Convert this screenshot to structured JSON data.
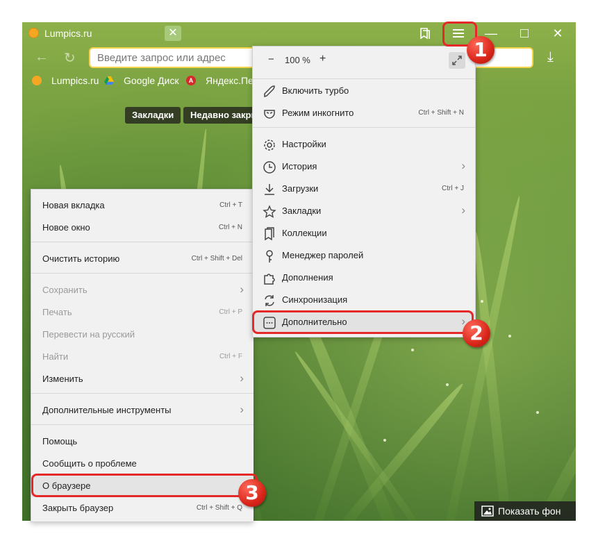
{
  "tab": {
    "title": "Lumpics.ru",
    "close_glyph": "✕"
  },
  "window_controls": {
    "collections_icon": "bookmark-stack-icon",
    "menu_icon": "hamburger-menu-icon",
    "minimize": "—",
    "maximize": "□",
    "close": "✕"
  },
  "address": {
    "placeholder": "Введите запрос или адрес"
  },
  "bookmarks_bar": [
    {
      "label": "Lumpics.ru",
      "icon": "orange-circle-icon"
    },
    {
      "label": "Google Диск",
      "icon": "google-drive-icon"
    },
    {
      "label": "Яндекс.Пер",
      "icon": "yandex-translate-icon"
    }
  ],
  "newtab": {
    "bookmarks_label": "Закладки",
    "recent_label": "Недавно закры"
  },
  "main_menu": {
    "zoom": {
      "minus": "−",
      "value": "100 %",
      "plus": "+"
    },
    "items": [
      {
        "label": "Включить турбо",
        "shortcut": "",
        "icon": "rocket-icon"
      },
      {
        "label": "Режим инкогнито",
        "shortcut": "Ctrl + Shift + N",
        "icon": "incognito-mask-icon"
      },
      {
        "label": "Настройки",
        "shortcut": "",
        "icon": "gear-icon"
      },
      {
        "label": "История",
        "shortcut": "",
        "icon": "clock-icon"
      },
      {
        "label": "Загрузки",
        "shortcut": "Ctrl + J",
        "icon": "download-icon"
      },
      {
        "label": "Закладки",
        "shortcut": "",
        "icon": "star-icon"
      },
      {
        "label": "Коллекции",
        "shortcut": "",
        "icon": "collections-icon"
      },
      {
        "label": "Менеджер паролей",
        "shortcut": "",
        "icon": "key-icon"
      },
      {
        "label": "Дополнения",
        "shortcut": "",
        "icon": "puzzle-icon"
      },
      {
        "label": "Синхронизация",
        "shortcut": "",
        "icon": "sync-icon"
      },
      {
        "label": "Дополнительно",
        "shortcut": "",
        "icon": "more-dots-icon"
      }
    ]
  },
  "sub_menu": {
    "items": [
      {
        "label": "Новая вкладка",
        "shortcut": "Ctrl + T"
      },
      {
        "label": "Новое окно",
        "shortcut": "Ctrl + N"
      },
      {
        "label": "Очистить историю",
        "shortcut": "Ctrl + Shift + Del"
      },
      {
        "label": "Сохранить",
        "shortcut": ""
      },
      {
        "label": "Печать",
        "shortcut": "Ctrl + P"
      },
      {
        "label": "Перевести на русский",
        "shortcut": ""
      },
      {
        "label": "Найти",
        "shortcut": "Ctrl + F"
      },
      {
        "label": "Изменить",
        "shortcut": ""
      },
      {
        "label": "Дополнительные инструменты",
        "shortcut": ""
      },
      {
        "label": "Помощь",
        "shortcut": ""
      },
      {
        "label": "Сообщить о проблеме",
        "shortcut": ""
      },
      {
        "label": "О браузере",
        "shortcut": ""
      },
      {
        "label": "Закрыть браузер",
        "shortcut": "Ctrl + Shift + Q"
      }
    ]
  },
  "annotations": {
    "step1": "1",
    "step2": "2",
    "step3": "3",
    "callout_color": "#e52828"
  },
  "show_background": {
    "label": "Показать фон",
    "icon": "image-icon"
  }
}
